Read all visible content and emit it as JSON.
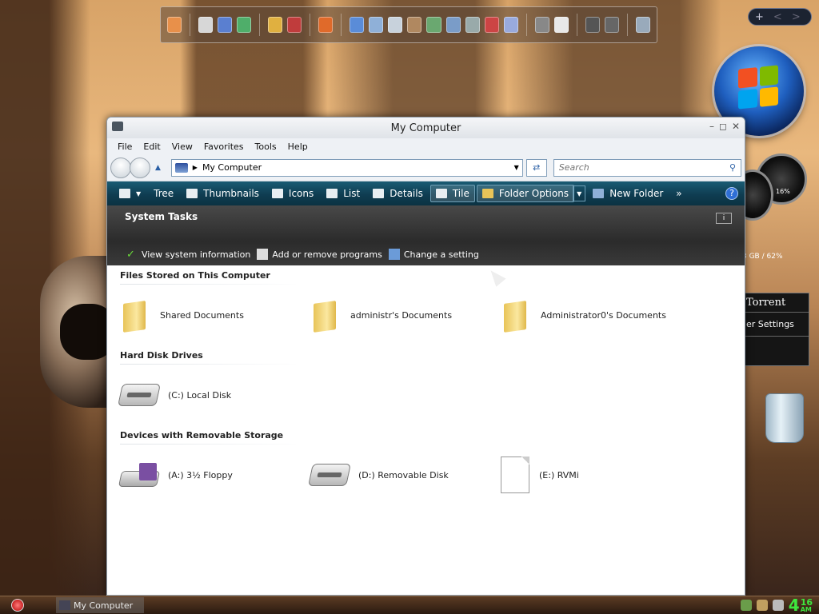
{
  "window": {
    "title": "My Computer",
    "menu": [
      "File",
      "Edit",
      "View",
      "Favorites",
      "Tools",
      "Help"
    ],
    "address": "My Computer",
    "search_placeholder": "Search"
  },
  "toolbar": {
    "buttons": [
      "Tree",
      "Thumbnails",
      "Icons",
      "List",
      "Details",
      "Tile",
      "Folder Options",
      "New Folder"
    ],
    "more": "»",
    "help": "?"
  },
  "system_tasks": {
    "title": "System Tasks",
    "info_label": "i",
    "links": [
      "View system information",
      "Add or remove programs",
      "Change a setting"
    ]
  },
  "groups": [
    {
      "title": "Files Stored on This Computer",
      "items": [
        "Shared Documents",
        "administr's Documents",
        "Administrator0's Documents"
      ]
    },
    {
      "title": "Hard Disk Drives",
      "items": [
        "(C:) Local Disk"
      ]
    },
    {
      "title": "Devices with Removable Storage",
      "items": [
        "(A:) 3½ Floppy",
        "(D:) Removable Disk",
        "(E:) RVMi"
      ]
    }
  ],
  "sidebar": {
    "controls": [
      "+",
      "<",
      ">"
    ],
    "gauge_percent": "16%",
    "memory_text": "3 GB / 62%",
    "torrent_title": "Torrent",
    "torrent_settings": "er Settings"
  },
  "taskbar": {
    "task_label": "My Computer",
    "clock_hour": "4",
    "clock_min": "16",
    "clock_ampm": "AM"
  },
  "colors": {
    "toolbar_bg": "#0f3d52",
    "tasks_bg": "#2b2b2b",
    "clock_green": "#3ee63e"
  }
}
